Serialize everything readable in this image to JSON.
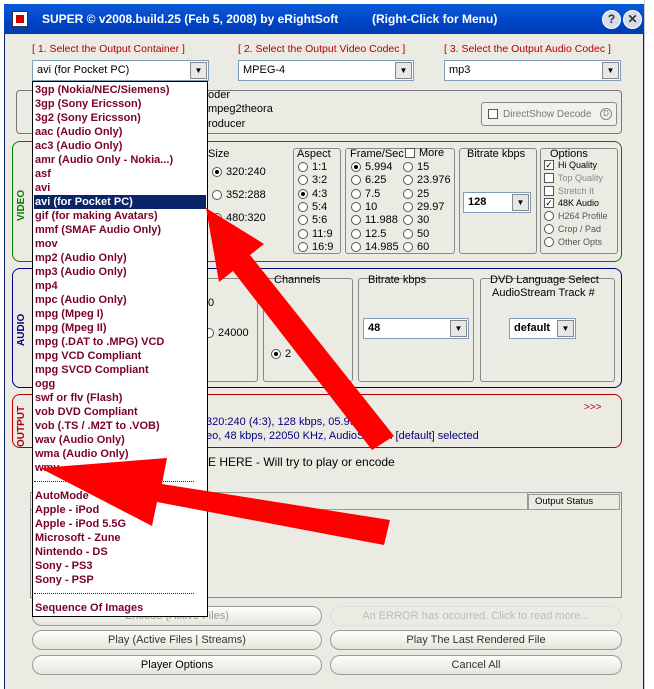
{
  "title": {
    "text": "SUPER © v2008.build.25 (Feb 5, 2008) by eRightSoft",
    "right_click": "(Right-Click for Menu)"
  },
  "headers": {
    "container": "[ 1.    Select the Output Container ]",
    "video_codec": "[ 2.   Select the Output Video Codec ]",
    "audio_codec": "[ 3.   Select the Output Audio Codec ]"
  },
  "selects": {
    "container": "avi  (for Pocket PC)",
    "video_codec": "MPEG-4",
    "audio_codec": "mp3"
  },
  "encoder": {
    "label_partial": "oder",
    "line1": "mpeg2theora",
    "line2": "roducer",
    "directshow": "DirectShow Decode"
  },
  "video": {
    "side_label": "VIDEO",
    "size_label": "Size",
    "sizes": [
      "320:240",
      "352:288",
      "480:320"
    ],
    "aspect_label": "Aspect",
    "aspects": [
      "1:1",
      "3:2",
      "4:3",
      "5:4",
      "5:6",
      "11:9",
      "16:9"
    ],
    "fps_label": "Frame/Sec",
    "more_label": "More",
    "fps_col1": [
      "5.994",
      "6.25",
      "7.5",
      "10",
      "11.988",
      "12.5",
      "14.985"
    ],
    "fps_col2": [
      "15",
      "23.976",
      "25",
      "29.97",
      "30",
      "50",
      "60"
    ],
    "bitrate_label": "Bitrate  kbps",
    "bitrate_value": "128",
    "options_label": "Options",
    "options": [
      "Hi Quality",
      "Top Quality",
      "Stretch  It",
      "48K Audio",
      "H264 Profile",
      "Crop / Pad",
      "Other Opts"
    ]
  },
  "audio": {
    "side_label": "AUDIO",
    "freq_partial": [
      "0",
      "24000"
    ],
    "channels_label": "Channels",
    "channels": [
      "1",
      "2"
    ],
    "bitrate_label": "Bitrate  kbps",
    "bitrate_value": "48",
    "dvd_label": "DVD Language Select",
    "dvd_sub": "AudioStream  Track #",
    "dvd_value": "default"
  },
  "output": {
    "side_label": "OUTPUT",
    "more": ">>>",
    "line1": "320:240 (4:3),  128 kbps,  05.994 fps",
    "line2": "eo,  48 kbps,  22050 KHz,  AudioStream [default] selected"
  },
  "drop_text": "E HERE - Will try to play or encode",
  "file_table": {
    "status_header": "Output Status"
  },
  "buttons": {
    "encode": "Encode (Active Files)",
    "error": "An ERROR has occurred. Click to read more...",
    "play_active": "Play (Active Files | Streams)",
    "play_last": "Play The Last Rendered File",
    "player_options": "Player Options",
    "cancel_all": "Cancel All"
  },
  "dropdown": {
    "items": [
      "3gp  (Nokia/NEC/Siemens)",
      "3gp  (Sony Ericsson)",
      "3g2  (Sony Ericsson)",
      "aac  (Audio Only)",
      "ac3  (Audio Only)",
      "amr  (Audio Only - Nokia...)",
      "asf",
      "avi",
      "avi  (for Pocket PC)",
      "gif  (for making Avatars)",
      "mmf  (SMAF Audio Only)",
      "mov",
      "mp2  (Audio Only)",
      "mp3  (Audio Only)",
      "mp4",
      "mpc  (Audio Only)",
      "mpg  (Mpeg I)",
      "mpg  (Mpeg II)",
      "mpg  (.DAT to .MPG) VCD",
      "mpg  VCD Compliant",
      "mpg  SVCD Compliant",
      "ogg",
      "swf or flv (Flash)",
      "vob  DVD Compliant",
      "vob  (.TS / .M2T to .VOB)",
      "wav (Audio Only)",
      "wma (Audio Only)",
      "wmv"
    ],
    "selected_index": 8,
    "devices": [
      "AutoMode",
      "Apple - iPod",
      "Apple - iPod 5.5G",
      "Microsoft - Zune",
      "Nintendo - DS",
      "Sony - PS3",
      "Sony - PSP"
    ],
    "sequence": "Sequence Of Images"
  },
  "colors": {
    "titlebar": "#0046c8",
    "video_group": "#008000",
    "audio_group": "#000080",
    "output_group": "#b00000",
    "label_red": "#b00000",
    "dropdown_text": "#7a0030",
    "selection": "#0a246a",
    "arrow": "#ff0000"
  }
}
